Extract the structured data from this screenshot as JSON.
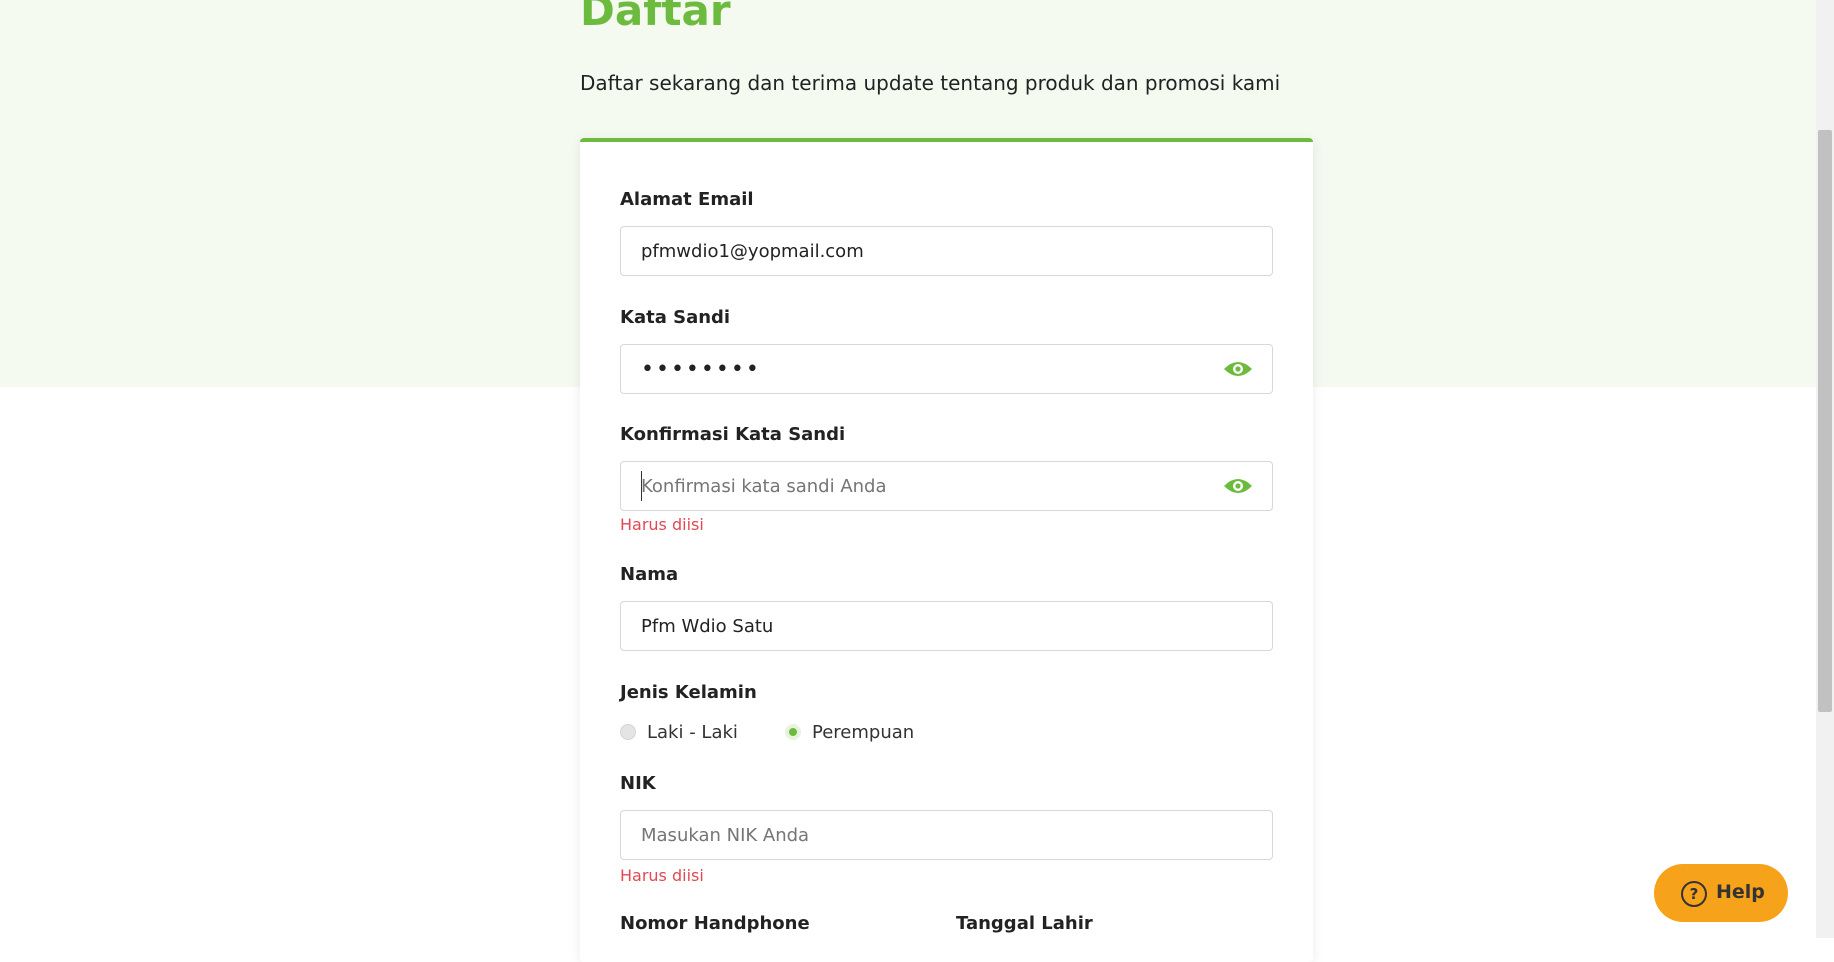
{
  "header": {
    "title": "Daftar",
    "subtitle": "Daftar sekarang dan terima update tentang produk dan promosi kami"
  },
  "form": {
    "email": {
      "label": "Alamat Email",
      "value": "pfmwdio1@yopmail.com"
    },
    "password": {
      "label": "Kata Sandi",
      "value": "••••••••"
    },
    "confirm_password": {
      "label": "Konfirmasi Kata Sandi",
      "placeholder": "Konfirmasi kata sandi Anda",
      "error": "Harus diisi"
    },
    "name": {
      "label": "Nama",
      "value": "Pfm Wdio Satu"
    },
    "gender": {
      "label": "Jenis Kelamin",
      "options": [
        "Laki - Laki",
        "Perempuan"
      ],
      "selected": "Perempuan"
    },
    "nik": {
      "label": "NIK",
      "placeholder": "Masukan NIK Anda",
      "error": "Harus diisi"
    },
    "phone": {
      "label": "Nomor Handphone"
    },
    "birth_date": {
      "label": "Tanggal Lahir"
    }
  },
  "help": {
    "label": "Help"
  },
  "colors": {
    "brand_green": "#6dbb3e",
    "error_red": "#e04a54",
    "help_orange": "#f7a21b",
    "hero_bg": "#f4faf0"
  },
  "icons": {
    "password_toggle": "eye-icon",
    "help": "question-circle-icon"
  }
}
